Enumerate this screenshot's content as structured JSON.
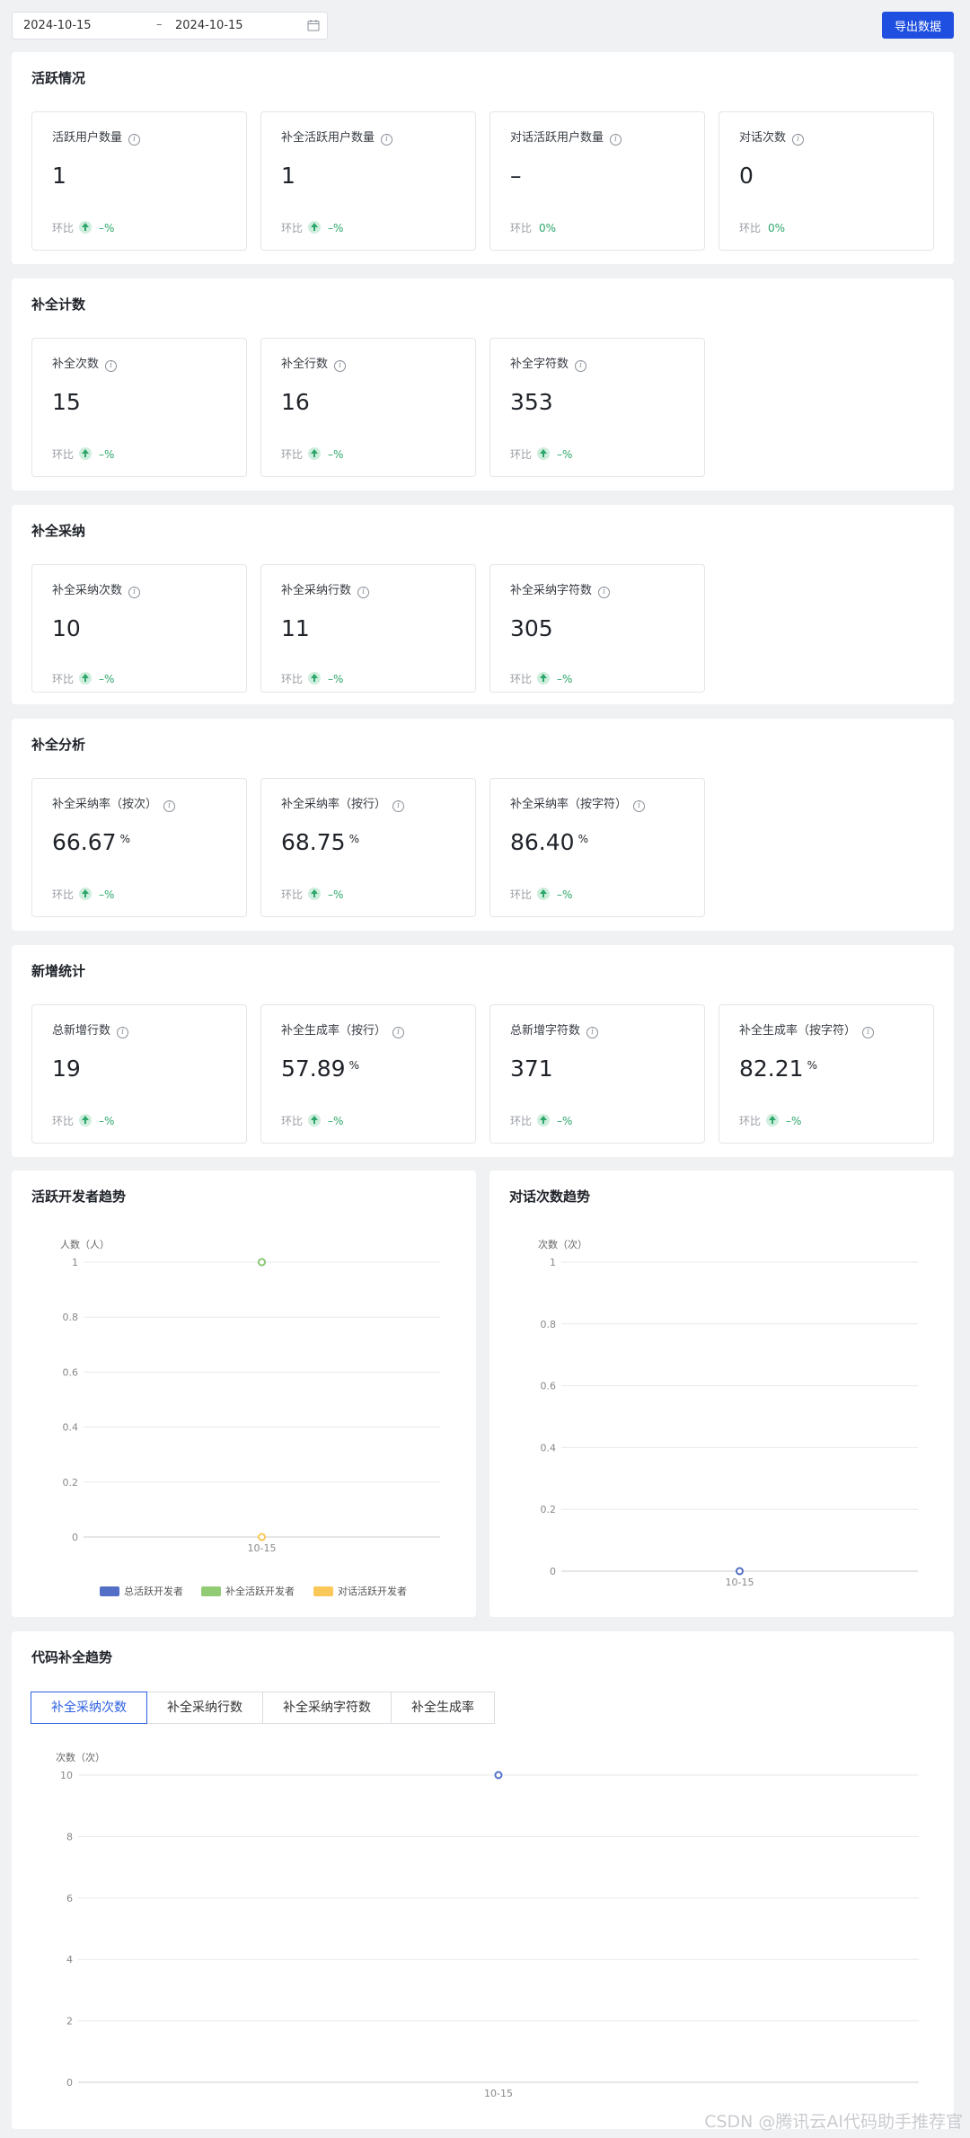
{
  "filter": {
    "start_date": "2024-10-15",
    "separator": "–",
    "end_date": "2024-10-15",
    "calendar_icon": "calendar-icon"
  },
  "export_button": "导出数据",
  "trend_label": "环比",
  "sections": {
    "active": {
      "title": "活跃情况",
      "cards": [
        {
          "label": "活跃用户数量",
          "value": "1",
          "trend": "–%"
        },
        {
          "label": "补全活跃用户数量",
          "value": "1",
          "trend": "–%"
        },
        {
          "label": "对话活跃用户数量",
          "value": "–",
          "trend": "0%"
        },
        {
          "label": "对话次数",
          "value": "0",
          "trend": "0%"
        }
      ]
    },
    "completion_count": {
      "title": "补全计数",
      "cards": [
        {
          "label": "补全次数",
          "value": "15",
          "trend": "–%"
        },
        {
          "label": "补全行数",
          "value": "16",
          "trend": "–%"
        },
        {
          "label": "补全字符数",
          "value": "353",
          "trend": "–%"
        }
      ]
    },
    "adoption": {
      "title": "补全采纳",
      "cards": [
        {
          "label": "补全采纳次数",
          "value": "10",
          "trend": "–%"
        },
        {
          "label": "补全采纳行数",
          "value": "11",
          "trend": "–%"
        },
        {
          "label": "补全采纳字符数",
          "value": "305",
          "trend": "–%"
        }
      ]
    },
    "analysis": {
      "title": "补全分析",
      "cards": [
        {
          "label": "补全采纳率（按次）",
          "value": "66.67",
          "unit": "%",
          "trend": "–%"
        },
        {
          "label": "补全采纳率（按行）",
          "value": "68.75",
          "unit": "%",
          "trend": "–%"
        },
        {
          "label": "补全采纳率（按字符）",
          "value": "86.40",
          "unit": "%",
          "trend": "–%"
        }
      ]
    },
    "new_stats": {
      "title": "新增统计",
      "cards": [
        {
          "label": "总新增行数",
          "value": "19",
          "trend": "–%"
        },
        {
          "label": "补全生成率（按行）",
          "value": "57.89",
          "unit": "%",
          "trend": "–%"
        },
        {
          "label": "总新增字符数",
          "value": "371",
          "trend": "–%"
        },
        {
          "label": "补全生成率（按字符）",
          "value": "82.21",
          "unit": "%",
          "trend": "–%"
        }
      ]
    }
  },
  "code_trend": {
    "title": "代码补全趋势",
    "tabs": [
      "补全采纳次数",
      "补全采纳行数",
      "补全采纳字符数",
      "补全生成率"
    ],
    "active_tab": 0
  },
  "watermark": "CSDN @腾讯云AI代码助手推荐官",
  "chart_data": [
    {
      "type": "line",
      "title": "活跃开发者趋势",
      "ylabel": "人数（人）",
      "categories": [
        "10-15"
      ],
      "ylim": [
        0,
        1
      ],
      "yticks": [
        "0",
        "0.2",
        "0.4",
        "0.6",
        "0.8",
        "1"
      ],
      "grid": true,
      "legend_position": "bottom",
      "series": [
        {
          "name": "总活跃开发者",
          "values": [
            1
          ],
          "color": "#5470c6"
        },
        {
          "name": "补全活跃开发者",
          "values": [
            1
          ],
          "color": "#91cc75"
        },
        {
          "name": "对话活跃开发者",
          "values": [
            0
          ],
          "color": "#fac858"
        }
      ]
    },
    {
      "type": "line",
      "title": "对话次数趋势",
      "ylabel": "次数（次）",
      "categories": [
        "10-15"
      ],
      "ylim": [
        0,
        1
      ],
      "yticks": [
        "0",
        "0.2",
        "0.4",
        "0.6",
        "0.8",
        "1"
      ],
      "grid": true,
      "series": [
        {
          "values": [
            0
          ],
          "color": "#5470c6"
        }
      ]
    },
    {
      "type": "line",
      "title": "代码补全趋势",
      "ylabel": "次数（次）",
      "categories": [
        "10-15"
      ],
      "ylim": [
        0,
        10
      ],
      "yticks": [
        "0",
        "2",
        "4",
        "6",
        "8",
        "10"
      ],
      "grid": true,
      "series": [
        {
          "values": [
            10
          ],
          "color": "#5470c6"
        }
      ]
    }
  ]
}
